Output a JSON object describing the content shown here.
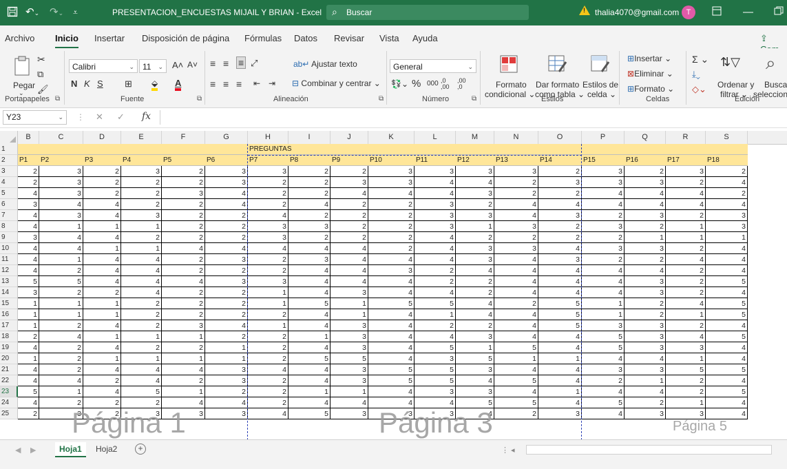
{
  "titlebar": {
    "save_icon": "save-icon",
    "undo_icon": "undo-icon",
    "redo_icon": "redo-icon",
    "title": "PRESENTACION_ENCUESTAS MIJAIL Y BRIAN  -  Excel",
    "search_placeholder": "Buscar",
    "account_email": "thalia4070@gmail.com",
    "avatar_initial": "T",
    "warning_glyph": "!",
    "color_bar": "#217346"
  },
  "menu": {
    "items": [
      "Archivo",
      "Inicio",
      "Insertar",
      "Disposición de página",
      "Fórmulas",
      "Datos",
      "Revisar",
      "Vista",
      "Ayuda"
    ],
    "active": "Inicio",
    "share_label": "Com"
  },
  "ribbon": {
    "clipboard": {
      "paste": "Pegar",
      "label": "Portapapeles"
    },
    "font": {
      "name": "Calibri",
      "size": "11",
      "bold": "N",
      "italic": "K",
      "underline": "S",
      "grow": "A˄",
      "shrink": "A˅",
      "label": "Fuente",
      "fill_color": "#ffd800",
      "font_color": "#e81123"
    },
    "alignment": {
      "wrap": "Ajustar texto",
      "merge": "Combinar y centrar",
      "label": "Alineación"
    },
    "number": {
      "format": "General",
      "percent": "%",
      "thousands": "000",
      "dec_inc": ",0 ,00",
      "dec_dec": ",00 ,0",
      "label": "Número"
    },
    "styles": {
      "conditional": "Formato",
      "conditional2": "condicional",
      "as_table": "Dar formato",
      "as_table2": "como tabla",
      "cell_styles": "Estilos de",
      "cell_styles2": "celda",
      "label": "Estilos"
    },
    "cells": {
      "insert": "Insertar",
      "delete": "Eliminar",
      "format": "Formato",
      "label": "Celdas"
    },
    "editing": {
      "sort": "Ordenar y",
      "sort2": "filtrar",
      "find": "Buscar",
      "find2": "seleccionar",
      "label": "Edición"
    }
  },
  "formula_bar": {
    "name_box": "Y23",
    "fx": "fx",
    "value": ""
  },
  "sheet": {
    "columns": [
      "B",
      "C",
      "D",
      "E",
      "F",
      "G",
      "H",
      "I",
      "J",
      "K",
      "L",
      "M",
      "N",
      "O",
      "P",
      "Q",
      "R",
      "S"
    ],
    "row1_label": "PREGUNTAS",
    "row2_labels": [
      "P1",
      "P2",
      "P3",
      "P4",
      "P5",
      "P6",
      "P7",
      "P8",
      "P9",
      "P10",
      "P11",
      "P12",
      "P13",
      "P14",
      "P15",
      "P16",
      "P17",
      "P18"
    ],
    "selected_row": "23",
    "rows": [
      {
        "n": "3",
        "v": [
          2,
          3,
          2,
          3,
          2,
          3,
          3,
          2,
          2,
          3,
          3,
          3,
          3,
          2,
          3,
          2,
          3,
          2
        ]
      },
      {
        "n": "4",
        "v": [
          2,
          3,
          2,
          2,
          2,
          3,
          2,
          2,
          3,
          3,
          4,
          4,
          2,
          3,
          3,
          3,
          2,
          4
        ]
      },
      {
        "n": "5",
        "v": [
          4,
          3,
          2,
          2,
          3,
          4,
          2,
          2,
          4,
          4,
          4,
          3,
          2,
          2,
          4,
          4,
          4,
          2
        ]
      },
      {
        "n": "6",
        "v": [
          3,
          4,
          4,
          2,
          2,
          4,
          2,
          4,
          2,
          2,
          3,
          2,
          4,
          4,
          4,
          4,
          4,
          4
        ]
      },
      {
        "n": "7",
        "v": [
          4,
          3,
          4,
          3,
          2,
          2,
          4,
          2,
          2,
          2,
          3,
          3,
          4,
          3,
          2,
          3,
          2,
          3
        ]
      },
      {
        "n": "8",
        "v": [
          4,
          1,
          1,
          1,
          2,
          2,
          3,
          3,
          2,
          2,
          3,
          1,
          3,
          2,
          3,
          2,
          1,
          3
        ]
      },
      {
        "n": "9",
        "v": [
          3,
          4,
          4,
          2,
          2,
          2,
          3,
          2,
          2,
          2,
          4,
          2,
          2,
          2,
          2,
          1,
          1,
          1
        ]
      },
      {
        "n": "10",
        "v": [
          4,
          4,
          1,
          1,
          4,
          4,
          4,
          4,
          4,
          2,
          4,
          3,
          3,
          4,
          3,
          3,
          2,
          4
        ]
      },
      {
        "n": "11",
        "v": [
          4,
          1,
          4,
          4,
          2,
          3,
          2,
          3,
          4,
          4,
          4,
          3,
          4,
          3,
          2,
          2,
          4,
          4
        ]
      },
      {
        "n": "12",
        "v": [
          4,
          2,
          4,
          4,
          2,
          2,
          2,
          4,
          4,
          3,
          2,
          4,
          4,
          4,
          4,
          4,
          2,
          4
        ]
      },
      {
        "n": "13",
        "v": [
          5,
          5,
          4,
          4,
          4,
          3,
          3,
          4,
          4,
          4,
          2,
          2,
          4,
          4,
          4,
          3,
          2,
          5
        ]
      },
      {
        "n": "14",
        "v": [
          3,
          2,
          2,
          4,
          2,
          2,
          1,
          4,
          3,
          4,
          4,
          2,
          4,
          4,
          4,
          3,
          2,
          4
        ]
      },
      {
        "n": "15",
        "v": [
          1,
          1,
          1,
          2,
          2,
          2,
          1,
          5,
          1,
          5,
          5,
          4,
          2,
          5,
          1,
          2,
          4,
          5
        ]
      },
      {
        "n": "16",
        "v": [
          1,
          1,
          1,
          2,
          2,
          2,
          2,
          4,
          1,
          4,
          1,
          4,
          4,
          5,
          1,
          2,
          1,
          5
        ]
      },
      {
        "n": "17",
        "v": [
          1,
          2,
          4,
          2,
          3,
          4,
          1,
          4,
          3,
          4,
          2,
          2,
          4,
          5,
          3,
          3,
          2,
          4
        ]
      },
      {
        "n": "18",
        "v": [
          2,
          4,
          1,
          1,
          1,
          2,
          2,
          1,
          3,
          4,
          4,
          3,
          4,
          4,
          5,
          3,
          4,
          5
        ]
      },
      {
        "n": "19",
        "v": [
          4,
          2,
          4,
          2,
          2,
          1,
          2,
          4,
          3,
          4,
          5,
          1,
          5,
          4,
          5,
          3,
          3,
          4
        ]
      },
      {
        "n": "20",
        "v": [
          1,
          2,
          1,
          1,
          1,
          1,
          2,
          5,
          5,
          4,
          3,
          5,
          1,
          1,
          4,
          4,
          1,
          4
        ]
      },
      {
        "n": "21",
        "v": [
          4,
          2,
          4,
          4,
          4,
          3,
          4,
          4,
          3,
          5,
          5,
          3,
          4,
          4,
          3,
          3,
          5,
          5
        ]
      },
      {
        "n": "22",
        "v": [
          4,
          4,
          2,
          4,
          2,
          3,
          2,
          4,
          3,
          5,
          5,
          4,
          5,
          4,
          2,
          1,
          2,
          4
        ]
      },
      {
        "n": "23",
        "v": [
          5,
          1,
          4,
          5,
          1,
          2,
          2,
          1,
          1,
          4,
          3,
          3,
          4,
          1,
          4,
          4,
          2,
          5
        ]
      },
      {
        "n": "24",
        "v": [
          4,
          2,
          2,
          2,
          4,
          4,
          2,
          4,
          4,
          4,
          4,
          5,
          5,
          4,
          5,
          2,
          1,
          4
        ]
      },
      {
        "n": "25",
        "v": [
          2,
          3,
          2,
          3,
          3,
          3,
          4,
          5,
          3,
          3,
          3,
          4,
          2,
          3,
          4,
          3,
          3,
          4
        ]
      }
    ]
  },
  "watermarks": {
    "p1": "Página 1",
    "p3": "Página 3",
    "p5": "Página 5"
  },
  "sheet_tabs": {
    "tabs": [
      "Hoja1",
      "Hoja2"
    ],
    "active": "Hoja1",
    "add": "+"
  }
}
